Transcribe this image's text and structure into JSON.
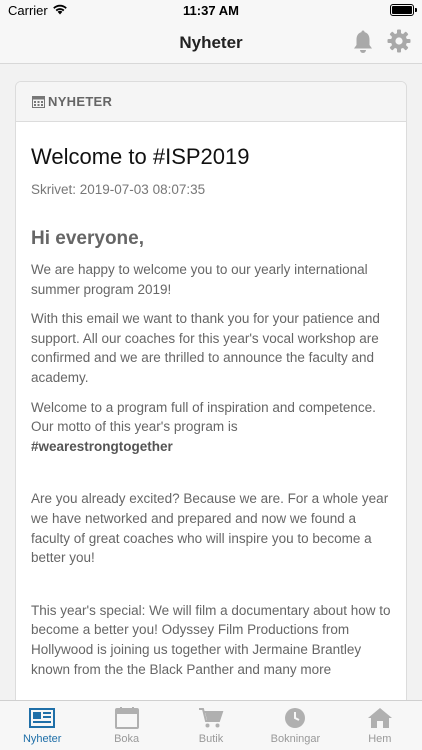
{
  "status_bar": {
    "carrier": "Carrier",
    "time": "11:37 AM"
  },
  "nav": {
    "title": "Nyheter",
    "right_icons": [
      "bell-icon",
      "gear-icon"
    ]
  },
  "card": {
    "header_icon": "calendar-icon",
    "header_label": "NYHETER",
    "title": "Welcome to #ISP2019",
    "date": "Skrivet: 2019-07-03 08:07:35",
    "greeting": "Hi everyone,",
    "paragraphs": [
      "We are happy to welcome you to our yearly international summer program 2019!",
      "With this email we want to thank you for your patience and support. All our coaches for this year's vocal workshop are confirmed and we are thrilled to announce the faculty and academy.",
      "Welcome to a program full of inspiration and competence. Our motto of this year's program is",
      "#wearestrongtogether",
      "Are you already excited? Because we are. For a whole year we have networked and prepared and now we found a faculty of great coaches who will inspire you to become a better you!",
      "This year's special: We will film a documentary about how to become a better you! Odyssey Film Productions from Hollywood is joining us together with Jermaine Brantley known from the the Black Panther and many more"
    ]
  },
  "tabs": [
    {
      "label": "Nyheter",
      "icon": "newspaper-icon",
      "active": true
    },
    {
      "label": "Boka",
      "icon": "calendar-icon",
      "active": false
    },
    {
      "label": "Butik",
      "icon": "cart-icon",
      "active": false
    },
    {
      "label": "Bokningar",
      "icon": "clock-icon",
      "active": false
    },
    {
      "label": "Hem",
      "icon": "home-icon",
      "active": false
    }
  ],
  "colors": {
    "accent": "#1f6fa8",
    "inactive": "#b0b0b0"
  }
}
